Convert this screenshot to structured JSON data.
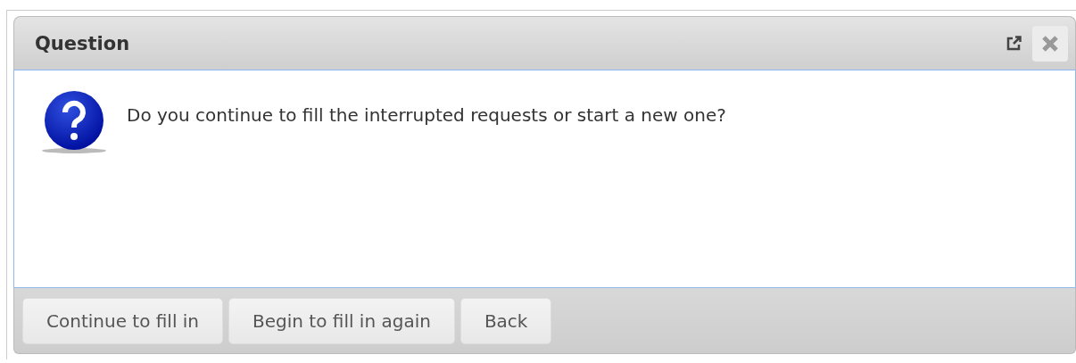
{
  "window": {
    "title": "Question"
  },
  "message": "Do you continue to fill the interrupted requests or start a new one?",
  "buttons": [
    {
      "label": "Continue to fill in"
    },
    {
      "label": "Begin to fill in again"
    },
    {
      "label": "Back"
    }
  ]
}
